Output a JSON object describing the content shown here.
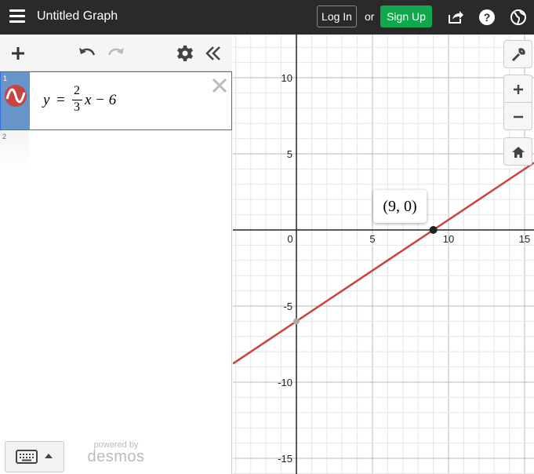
{
  "header": {
    "title": "Untitled Graph",
    "login_label": "Log In",
    "or_label": "or",
    "signup_label": "Sign Up"
  },
  "expressions": [
    {
      "index": "1",
      "latex_parts": {
        "lhs": "y",
        "eq": "=",
        "num": "2",
        "den": "3",
        "rest": "x − 6"
      },
      "color": "#c74440"
    },
    {
      "index": "2"
    }
  ],
  "footer": {
    "powered_by": "powered by",
    "brand": "desmos"
  },
  "graph": {
    "x_ticks": [
      "0",
      "5",
      "10",
      "15"
    ],
    "y_ticks": [
      "10",
      "5",
      "-5",
      "-10",
      "-15"
    ],
    "point_label": "(9, 0)",
    "line_color": "#c74440",
    "chart_data": {
      "type": "line",
      "equation": "y = 2/3 x - 6",
      "slope": 0.6667,
      "intercept": -6,
      "x_range": [
        -4.2,
        15.6
      ],
      "y_range": [
        -16,
        13
      ],
      "points": [
        {
          "x": 9,
          "y": 0
        },
        {
          "x": 0,
          "y": -6
        }
      ],
      "grid": true
    }
  },
  "icons": {
    "menu": "hamburger-icon",
    "share": "share-icon",
    "help": "help-icon",
    "language": "globe-icon",
    "add": "plus-icon",
    "undo": "undo-icon",
    "redo": "redo-icon",
    "settings": "gear-icon",
    "collapse": "double-chevron-left-icon",
    "wrench": "wrench-icon",
    "zoom_in": "zoom-in-icon",
    "zoom_out": "zoom-out-icon",
    "home": "home-icon",
    "keyboard": "keyboard-icon"
  }
}
